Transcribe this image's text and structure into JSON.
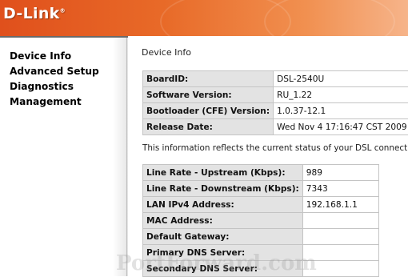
{
  "brand": {
    "logo_text": "D-Link",
    "trademark": "®"
  },
  "nav": {
    "items": [
      {
        "label": "Device Info"
      },
      {
        "label": "Advanced Setup"
      },
      {
        "label": "Diagnostics"
      },
      {
        "label": "Management"
      }
    ]
  },
  "page": {
    "title": "Device Info",
    "note": "This information reflects the current status of your DSL connection."
  },
  "device_table": [
    {
      "label": "BoardID:",
      "value": "DSL-2540U"
    },
    {
      "label": "Software Version:",
      "value": "RU_1.22"
    },
    {
      "label": "Bootloader (CFE) Version:",
      "value": "1.0.37-12.1"
    },
    {
      "label": "Release Date:",
      "value": "Wed Nov 4 17:16:47 CST 2009"
    }
  ],
  "status_table": [
    {
      "label": "Line Rate - Upstream (Kbps):",
      "value": "989"
    },
    {
      "label": "Line Rate - Downstream (Kbps):",
      "value": "7343"
    },
    {
      "label": "LAN IPv4 Address:",
      "value": "192.168.1.1"
    },
    {
      "label": "MAC Address:",
      "value": ""
    },
    {
      "label": "Default Gateway:",
      "value": ""
    },
    {
      "label": "Primary DNS Server:",
      "value": ""
    },
    {
      "label": "Secondary DNS Server:",
      "value": ""
    }
  ],
  "watermark": "PortForward.com",
  "colors": {
    "banner_start": "#e0501c",
    "banner_end": "#f6b48a",
    "label_cell_bg": "#e3e3e3"
  }
}
